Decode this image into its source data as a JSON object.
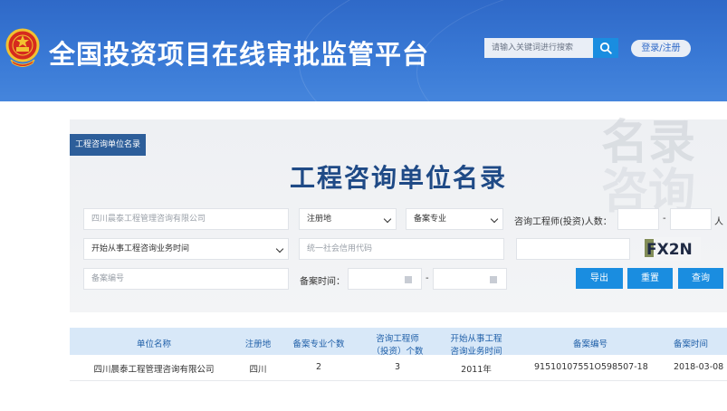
{
  "header": {
    "site_title": "全国投资项目在线审批监管平台",
    "search_placeholder": "请输入关键词进行搜索",
    "login_label": "登录/注册"
  },
  "panel": {
    "tag": "工程咨询单位名录",
    "watermark_line1": "名录",
    "watermark_line2": "咨询",
    "title": "工程咨询单位名录"
  },
  "form": {
    "company_name_value": "四川晨泰工程管理咨询有限公司",
    "region_select": "注册地",
    "specialty_select": "备案专业",
    "engineer_count_label": "咨询工程师(投资)人数：",
    "range_dash": "-",
    "unit_person": "人",
    "start_time_select": "开始从事工程咨询业务时间",
    "credit_code_placeholder": "统一社会信用代码",
    "captcha_text": "FX2N",
    "record_no_placeholder": "备案编号",
    "record_time_label": "备案时间："
  },
  "buttons": {
    "export": "导出",
    "reset": "重置",
    "query": "查询"
  },
  "table": {
    "headers": [
      {
        "line1": "单位名称",
        "line2": ""
      },
      {
        "line1": "注册地",
        "line2": ""
      },
      {
        "line1": "备案专业个数",
        "line2": ""
      },
      {
        "line1": "咨询工程师",
        "line2": "（投资）个数"
      },
      {
        "line1": "开始从事工程",
        "line2": "咨询业务时间"
      },
      {
        "line1": "备案编号",
        "line2": ""
      },
      {
        "line1": "备案时间",
        "line2": ""
      }
    ],
    "rows": [
      [
        "四川晨泰工程管理咨询有限公司",
        "四川",
        "2",
        "3",
        "2011年",
        "91510107551O598507-18",
        "2018-03-08"
      ]
    ]
  },
  "colors": {
    "header_blue": "#3a7ad6",
    "button_blue": "#1a8de0",
    "title_blue": "#1f4a86"
  }
}
